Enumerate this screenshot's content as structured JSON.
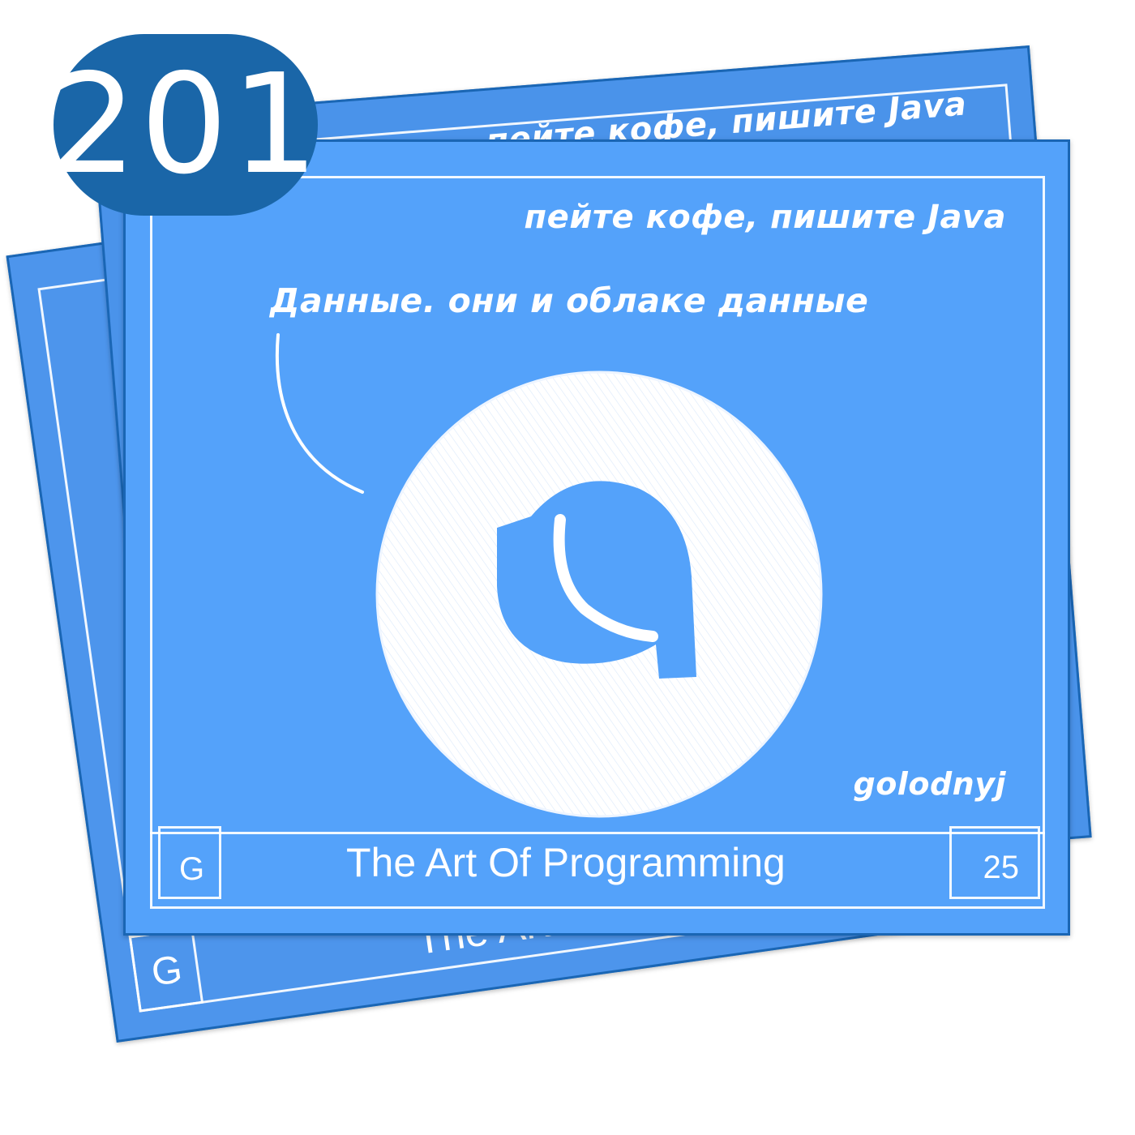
{
  "episode_number": "201",
  "card": {
    "slogan": "пейте кофе, пишите Java",
    "callout": "Данные. они и облаке данные",
    "author": "golodnyj",
    "footer_left": "G",
    "footer_title": "The Art Of Programming",
    "footer_right": "25"
  },
  "logo": {
    "icon": "podcast-logo-icon",
    "colors": {
      "ring": "#ffffff",
      "background": "#54a2fa"
    }
  },
  "colors": {
    "badge": "#1a66a8",
    "card_front": "#54a2fa",
    "card_back": "#4a93ea",
    "text": "#ffffff"
  }
}
